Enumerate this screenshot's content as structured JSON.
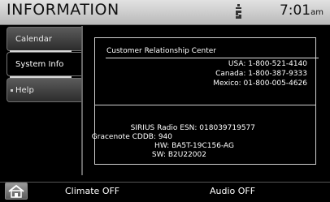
{
  "header": {
    "title": "INFORMATION",
    "status_icon": "signal-indicator-icon",
    "clock_time": "7:01",
    "clock_ampm": "am"
  },
  "sidebar": {
    "items": [
      {
        "label": "Calendar",
        "active": false
      },
      {
        "label": "System Info",
        "active": true
      },
      {
        "label": "Help",
        "active": false
      }
    ]
  },
  "contact": {
    "heading": "Customer Relationship Center",
    "lines": [
      "USA: 1-800-521-4140",
      "Canada: 1-800-387-9333",
      "Mexico: 01-800-005-4626"
    ]
  },
  "device": {
    "lines": [
      "SIRIUS Radio ESN: 018039719577",
      "Gracenote CDDB: 940",
      "HW: BA5T-19C156-AG",
      "SW: B2U22002"
    ]
  },
  "bottom_bar": {
    "home_icon": "home-icon",
    "climate_label": "Climate OFF",
    "audio_label": "Audio OFF"
  }
}
